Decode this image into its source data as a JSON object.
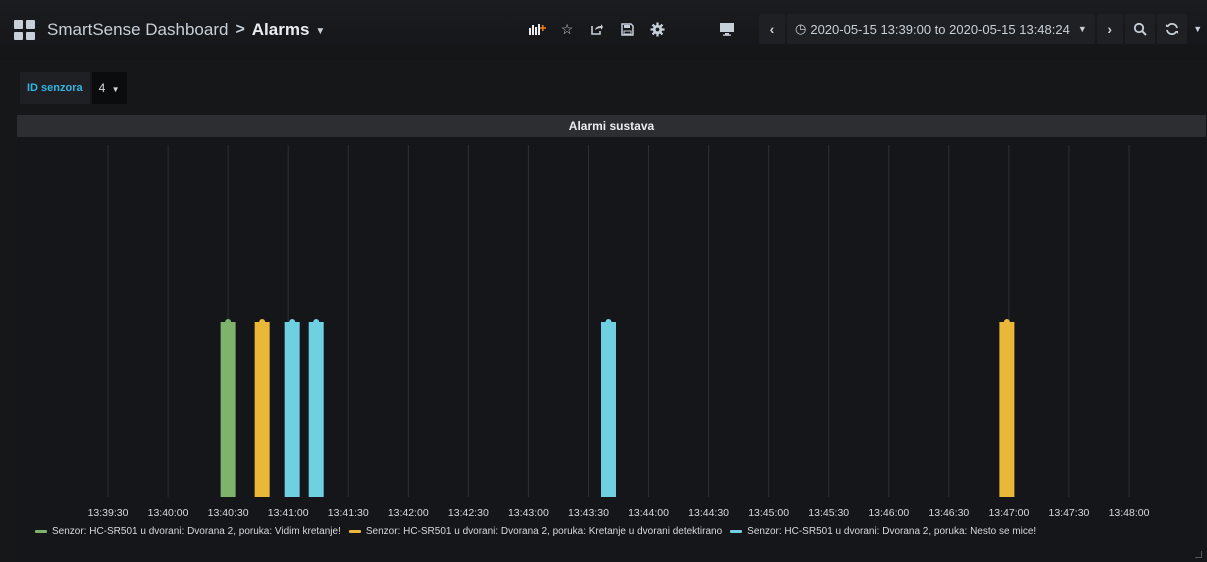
{
  "topbar": {
    "dashboard_name": "SmartSense Dashboard",
    "separator": ">",
    "page_name": "Alarms",
    "time_range": "2020-05-15 13:39:00 to 2020-05-15 13:48:24",
    "icons": [
      "add-panel-icon",
      "star-icon",
      "share-icon",
      "save-icon",
      "gear-icon",
      "tv-mode-icon",
      "chevron-left-icon",
      "clock-icon",
      "chevron-right-icon",
      "zoom-out-icon",
      "refresh-icon",
      "dropdown-icon"
    ]
  },
  "variable": {
    "label": "ID senzora",
    "value": "4"
  },
  "panel": {
    "title": "Alarmi sustava"
  },
  "colors": {
    "green": "#7eb26d",
    "yellow": "#eab839",
    "cyan": "#6ed0e0",
    "grid": "#2e2f32",
    "axis_text": "#d8d9da"
  },
  "chart_data": {
    "type": "bar",
    "x_ticks": [
      "13:39:30",
      "13:40:00",
      "13:40:30",
      "13:41:00",
      "13:41:30",
      "13:42:00",
      "13:42:30",
      "13:43:00",
      "13:43:30",
      "13:44:00",
      "13:44:30",
      "13:45:00",
      "13:45:30",
      "13:46:00",
      "13:46:30",
      "13:47:00",
      "13:47:30",
      "13:48:00"
    ],
    "ylim": [
      0,
      1
    ],
    "series": [
      {
        "name": "Senzor: HC-SR501 u dvorani: Dvorana 2, poruka: Vidim kretanje!",
        "color": "#7eb26d",
        "points": [
          {
            "x": "13:40:30",
            "y": 1
          }
        ]
      },
      {
        "name": "Senzor: HC-SR501 u dvorani: Dvorana 2, poruka: Kretanje u dvorani detektirano",
        "color": "#eab839",
        "points": [
          {
            "x": "13:40:47",
            "y": 1
          },
          {
            "x": "13:46:59",
            "y": 1
          }
        ]
      },
      {
        "name": "Senzor: HC-SR501 u dvorani: Dvorana 2, poruka: Nesto se mice!",
        "color": "#6ed0e0",
        "points": [
          {
            "x": "13:41:02",
            "y": 1
          },
          {
            "x": "13:41:14",
            "y": 1
          },
          {
            "x": "13:43:40",
            "y": 1
          }
        ]
      }
    ],
    "grid": true,
    "legend": "bottom"
  }
}
